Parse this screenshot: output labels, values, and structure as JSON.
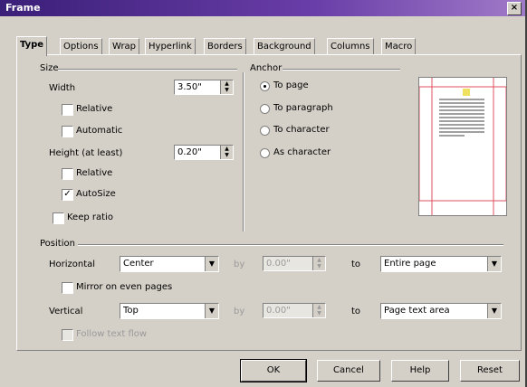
{
  "window": {
    "title": "Frame"
  },
  "tabs": [
    {
      "label": "Type"
    },
    {
      "label": "Options"
    },
    {
      "label": "Wrap"
    },
    {
      "label": "Hyperlink"
    },
    {
      "label": "Borders"
    },
    {
      "label": "Background"
    },
    {
      "label": "Columns"
    },
    {
      "label": "Macro"
    }
  ],
  "size": {
    "group_label": "Size",
    "width_label": "Width",
    "width_value": "3.50\"",
    "relative1_label": "Relative",
    "automatic_label": "Automatic",
    "height_label": "Height (at least)",
    "height_value": "0.20\"",
    "relative2_label": "Relative",
    "autosize_label": "AutoSize",
    "keep_ratio_label": "Keep ratio"
  },
  "anchor": {
    "group_label": "Anchor",
    "options": [
      "To page",
      "To paragraph",
      "To character",
      "As character"
    ],
    "selected": "To page"
  },
  "position": {
    "group_label": "Position",
    "horizontal_label": "Horizontal",
    "horizontal_value": "Center",
    "h_by_label": "by",
    "h_by_value": "0.00\"",
    "h_to_label": "to",
    "h_to_value": "Entire page",
    "mirror_label": "Mirror on even pages",
    "vertical_label": "Vertical",
    "vertical_value": "Top",
    "v_by_label": "by",
    "v_by_value": "0.00\"",
    "v_to_label": "to",
    "v_to_value": "Page text area",
    "follow_label": "Follow text flow"
  },
  "buttons": {
    "ok": "OK",
    "cancel": "Cancel",
    "help": "Help",
    "reset": "Reset"
  }
}
